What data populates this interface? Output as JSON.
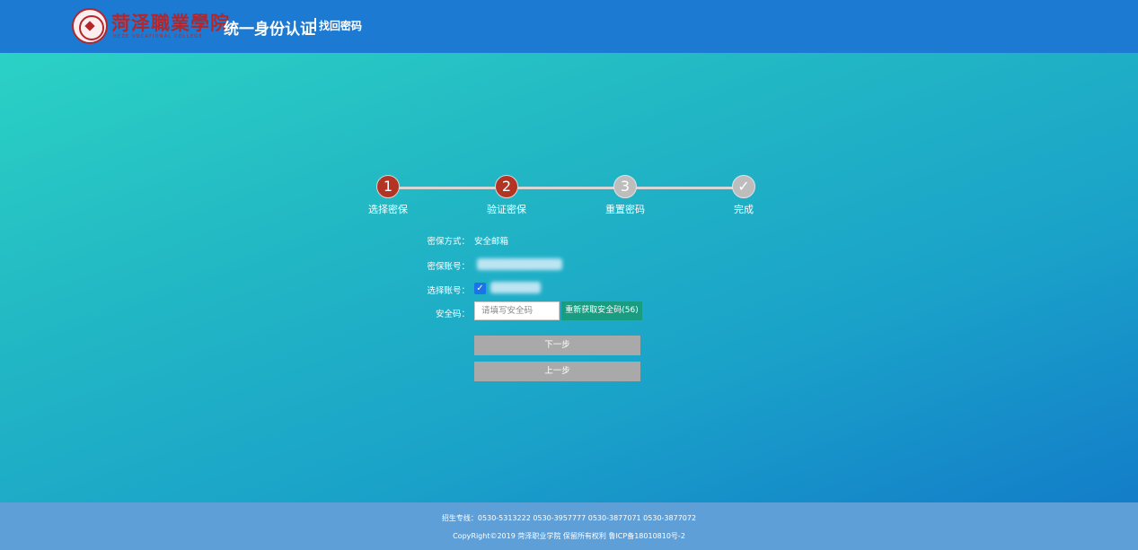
{
  "header": {
    "logo_cn": "菏泽職業學院",
    "logo_en": "HEZE VOCATIONAL COLLEGE",
    "system_title": "统一身份认证",
    "subtitle": "找回密码"
  },
  "steps": [
    {
      "number": "1",
      "label": "选择密保",
      "state": "done"
    },
    {
      "number": "2",
      "label": "验证密保",
      "state": "done"
    },
    {
      "number": "3",
      "label": "重置密码",
      "state": "todo"
    },
    {
      "number": "✓",
      "label": "完成",
      "state": "todo"
    }
  ],
  "form": {
    "method_label": "密保方式：",
    "method_value": "安全邮箱",
    "account_label": "密保账号：",
    "select_label": "选择账号：",
    "select_checked": true,
    "code_label": "安全码：",
    "code_placeholder": "请填写安全码",
    "resend_label": "重新获取安全码(56)",
    "next_label": "下一步",
    "prev_label": "上一步"
  },
  "footer": {
    "hotline": "招生专线：0530-5313222 0530-3957777 0530-3877071 0530-3877072",
    "copyright": "CopyRight©2019 菏泽职业学院 保留所有权利 鲁ICP备18010810号-2"
  },
  "colors": {
    "header_bg": "#1c7ad2",
    "step_done": "#b43424",
    "step_todo": "#bdbdbd",
    "resend_bg": "#199d82",
    "button_bg": "#a9a9a9",
    "footer_bg": "#5f9fd8"
  }
}
